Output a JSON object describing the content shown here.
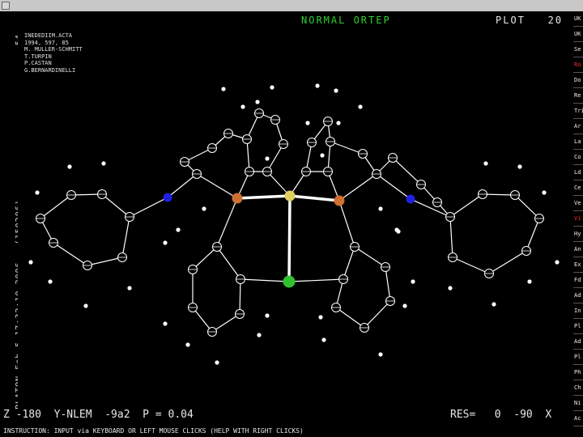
{
  "left_vertical_text": "PLATON-Feb  5 17:32:10 2006 - (150206)",
  "left_vertical_top": "54",
  "caption": [
    "INEDEDIIM.ACTA",
    "1994, 597, 85",
    "M. MULLER-SCHMITT",
    "T.TURPIN",
    "P.CASTAN",
    "G.BERNARDINELLI"
  ],
  "header": {
    "green": "NORMAL ORTEP",
    "right": "PLOT",
    "num": "20"
  },
  "status": {
    "left": "Z -180  Y-NLEM  -9a2  P = 0.04",
    "res": "RES=   0  -90  X"
  },
  "instruction": "INSTRUCTION: INPUT via KEYBOARD OR LEFT MOUSE CLICKS (HELP WITH RIGHT CLICKS)",
  "side_menu": [
    {
      "label": "UK",
      "color": "#f0f0f0"
    },
    {
      "label": "UK",
      "color": "#f0f0f0"
    },
    {
      "label": "Se",
      "color": "#f0f0f0"
    },
    {
      "label": "Ro",
      "color": "#ff3030"
    },
    {
      "label": "Do",
      "color": "#f0f0f0"
    },
    {
      "label": "Re",
      "color": "#f0f0f0"
    },
    {
      "label": "Tri",
      "color": "#f0f0f0"
    },
    {
      "label": "Ar",
      "color": "#f0f0f0"
    },
    {
      "label": "La",
      "color": "#f0f0f0"
    },
    {
      "label": "Co",
      "color": "#f0f0f0"
    },
    {
      "label": "Ld",
      "color": "#f0f0f0"
    },
    {
      "label": "Ce",
      "color": "#f0f0f0"
    },
    {
      "label": "Ve",
      "color": "#f0f0f0"
    },
    {
      "label": "Vi",
      "color": "#ff3030"
    },
    {
      "label": "Hy",
      "color": "#f0f0f0"
    },
    {
      "label": "An",
      "color": "#f0f0f0"
    },
    {
      "label": "Ex",
      "color": "#f0f0f0"
    },
    {
      "label": "Fd",
      "color": "#f0f0f0"
    },
    {
      "label": "Ad",
      "color": "#f0f0f0"
    },
    {
      "label": "In",
      "color": "#f0f0f0"
    },
    {
      "label": "Pl",
      "color": "#f0f0f0"
    },
    {
      "label": "Ad",
      "color": "#f0f0f0"
    },
    {
      "label": "Pl",
      "color": "#f0f0f0"
    },
    {
      "label": "Ph",
      "color": "#f0f0f0"
    },
    {
      "label": "Ch",
      "color": "#f0f0f0"
    },
    {
      "label": "Ni",
      "color": "#f0f0f0"
    },
    {
      "label": "Ac",
      "color": "#f0f0f0"
    }
  ],
  "atom_colors": {
    "carbon": "#ffffff",
    "phosphorus": "#d07030",
    "nitrogen": "#2020e0",
    "metal": "#e0d060",
    "chlorine": "#30c030"
  }
}
